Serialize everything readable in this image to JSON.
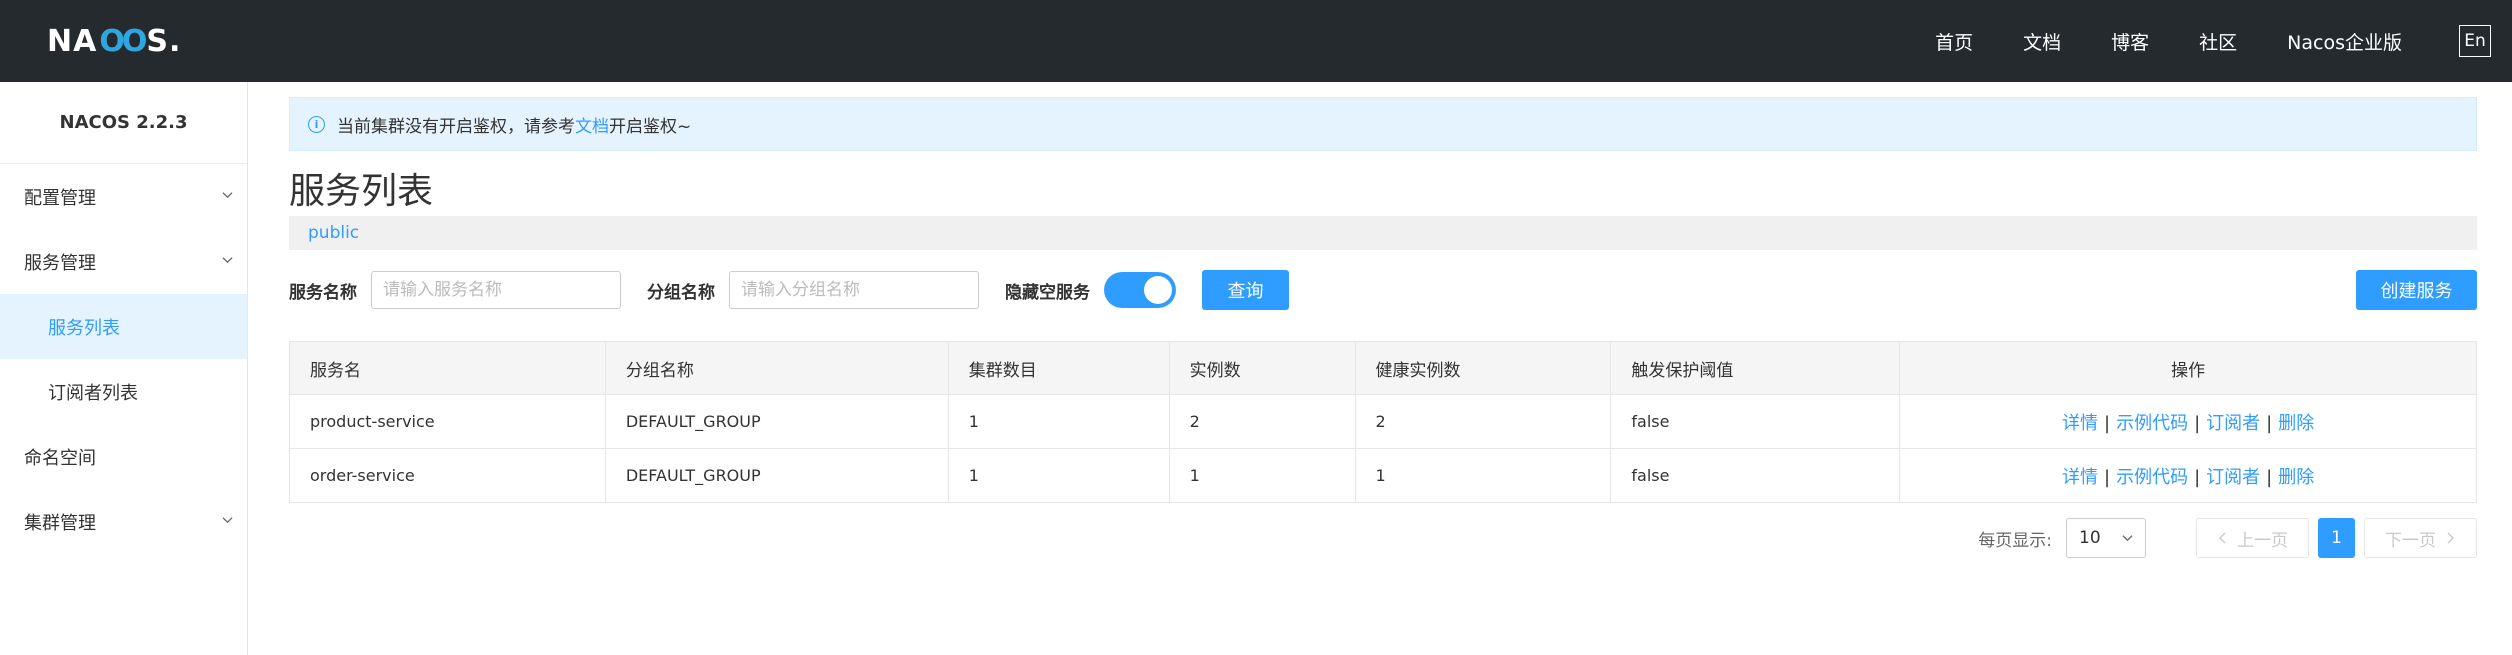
{
  "header": {
    "logo": {
      "part1": "NA",
      "part2": "OO",
      "part3": "S",
      "dot": "."
    },
    "nav": [
      "首页",
      "文档",
      "博客",
      "社区",
      "Nacos企业版"
    ],
    "lang": "En"
  },
  "sidebar": {
    "version": "NACOS 2.2.3",
    "items": [
      {
        "label": "配置管理"
      },
      {
        "label": "服务管理"
      },
      {
        "label": "服务列表"
      },
      {
        "label": "订阅者列表"
      },
      {
        "label": "命名空间"
      },
      {
        "label": "集群管理"
      }
    ]
  },
  "notice": {
    "before": "当前集群没有开启鉴权，请参考",
    "link": "文档",
    "after": "开启鉴权~"
  },
  "page": {
    "title": "服务列表",
    "namespace": "public"
  },
  "filter": {
    "service_label": "服务名称",
    "service_placeholder": "请输入服务名称",
    "group_label": "分组名称",
    "group_placeholder": "请输入分组名称",
    "hide_empty_label": "隐藏空服务",
    "hide_empty_on": true,
    "query_button": "查询",
    "create_button": "创建服务"
  },
  "table": {
    "headers": [
      "服务名",
      "分组名称",
      "集群数目",
      "实例数",
      "健康实例数",
      "触发保护阈值",
      "操作"
    ],
    "rows": [
      [
        "product-service",
        "DEFAULT_GROUP",
        "1",
        "2",
        "2",
        "false"
      ],
      [
        "order-service",
        "DEFAULT_GROUP",
        "1",
        "1",
        "1",
        "false"
      ]
    ],
    "ops": [
      "详情",
      "示例代码",
      "订阅者",
      "删除"
    ],
    "sep": "|"
  },
  "pagination": {
    "per_page_label": "每页显示:",
    "page_size": "10",
    "prev": "上一页",
    "current": "1",
    "next": "下一页"
  },
  "colors": {
    "header_bg": "#252a2f",
    "accent": "#2f9dff",
    "notice_bg": "#e5f3ff"
  }
}
